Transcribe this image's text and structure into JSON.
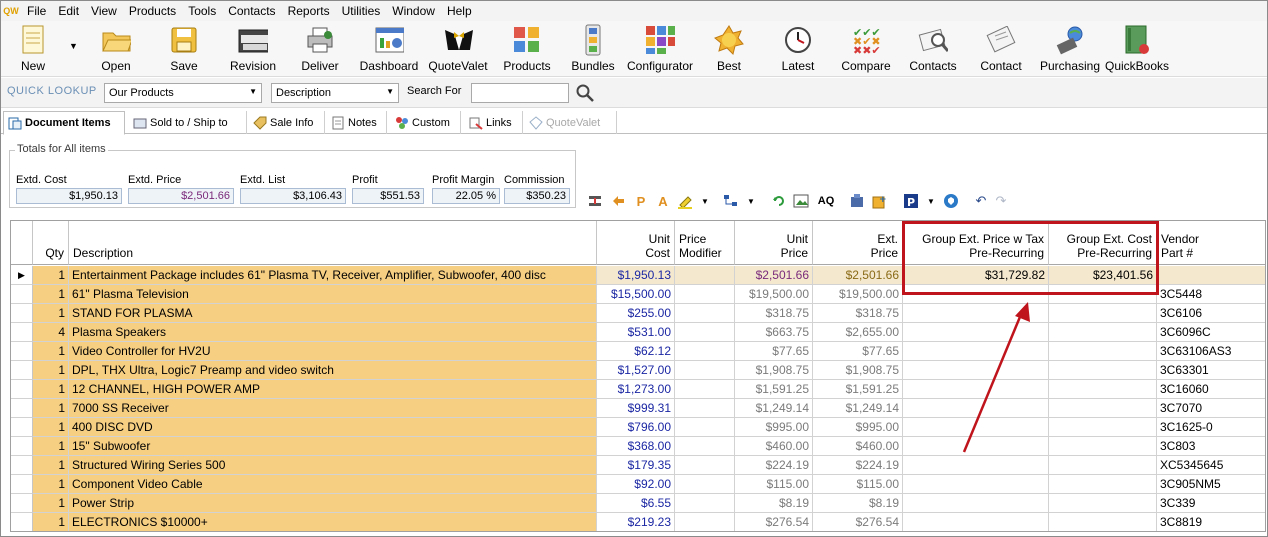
{
  "menu": [
    "File",
    "Edit",
    "View",
    "Products",
    "Tools",
    "Contacts",
    "Reports",
    "Utilities",
    "Window",
    "Help"
  ],
  "app_logo": "QW",
  "toolbar": [
    {
      "label": "New",
      "icon": "new-document-icon"
    },
    {
      "label": "Open",
      "icon": "open-folder-icon"
    },
    {
      "label": "Save",
      "icon": "save-disk-icon"
    },
    {
      "label": "Revision",
      "icon": "revision-icon"
    },
    {
      "label": "Deliver",
      "icon": "deliver-printer-icon"
    },
    {
      "label": "Dashboard",
      "icon": "dashboard-icon"
    },
    {
      "label": "QuoteValet",
      "icon": "quotevalet-tuxedo-icon"
    },
    {
      "label": "Products",
      "icon": "products-icon"
    },
    {
      "label": "Bundles",
      "icon": "bundles-icon"
    },
    {
      "label": "Configurator",
      "icon": "configurator-icon"
    },
    {
      "label": "Best",
      "icon": "best-badge-icon"
    },
    {
      "label": "Latest",
      "icon": "latest-clock-icon"
    },
    {
      "label": "Compare",
      "icon": "compare-check-icon"
    },
    {
      "label": "Contacts",
      "icon": "contacts-icon"
    },
    {
      "label": "Contact",
      "icon": "contact-card-icon"
    },
    {
      "label": "Purchasing",
      "icon": "purchasing-globe-icon"
    },
    {
      "label": "QuickBooks",
      "icon": "quickbooks-book-icon"
    }
  ],
  "lookup": {
    "label": "QUICK LOOKUP",
    "source": "Our Products",
    "field": "Description",
    "search_label": "Search For",
    "search_value": ""
  },
  "tabs": [
    {
      "label": "Document Items"
    },
    {
      "label": "Sold to / Ship to"
    },
    {
      "label": "Sale Info"
    },
    {
      "label": "Notes"
    },
    {
      "label": "Custom"
    },
    {
      "label": "Links"
    },
    {
      "label": "QuoteValet"
    }
  ],
  "totals": {
    "title": "Totals for All items",
    "items": [
      {
        "label": "Extd. Cost",
        "value": "$1,950.13"
      },
      {
        "label": "Extd. Price",
        "value": "$2,501.66"
      },
      {
        "label": "Extd. List",
        "value": "$3,106.43"
      },
      {
        "label": "Profit",
        "value": "$551.53"
      },
      {
        "label": "Profit Margin",
        "value": "22.05 %"
      },
      {
        "label": "Commission",
        "value": "$350.23"
      }
    ]
  },
  "grid_tools": {
    "letter_p": "P",
    "letter_a": "A",
    "letters_aq": "AQ"
  },
  "headers": {
    "qty": "Qty",
    "description": "Description",
    "unit_cost": [
      "Unit",
      "Cost"
    ],
    "price_modifier": [
      "Price",
      "Modifier"
    ],
    "unit_price": [
      "Unit",
      "Price"
    ],
    "ext_price": [
      "Ext.",
      "Price"
    ],
    "group_ext_price": [
      "Group Ext. Price w Tax",
      "Pre-Recurring"
    ],
    "group_ext_cost": [
      "Group Ext. Cost",
      "Pre-Recurring"
    ],
    "vendor_part": [
      "Vendor",
      "Part #"
    ]
  },
  "rows": [
    {
      "qty": "1",
      "description": "Entertainment Package includes 61\" Plasma TV, Receiver, Amplifier, Subwoofer, 400 disc",
      "unit_cost": "$1,950.13",
      "price_modifier": "",
      "unit_price": "$2,501.66",
      "ext_price": "$2,501.66",
      "group_ext_price": "$31,729.82",
      "group_ext_cost": "$23,401.56",
      "vendor_part": ""
    },
    {
      "qty": "1",
      "description": "61\" Plasma Television",
      "unit_cost": "$15,500.00",
      "price_modifier": "",
      "unit_price": "$19,500.00",
      "ext_price": "$19,500.00",
      "group_ext_price": "",
      "group_ext_cost": "",
      "vendor_part": "3C5448"
    },
    {
      "qty": "1",
      "description": "STAND FOR PLASMA",
      "unit_cost": "$255.00",
      "price_modifier": "",
      "unit_price": "$318.75",
      "ext_price": "$318.75",
      "group_ext_price": "",
      "group_ext_cost": "",
      "vendor_part": "3C6106"
    },
    {
      "qty": "4",
      "description": "Plasma Speakers",
      "unit_cost": "$531.00",
      "price_modifier": "",
      "unit_price": "$663.75",
      "ext_price": "$2,655.00",
      "group_ext_price": "",
      "group_ext_cost": "",
      "vendor_part": "3C6096C"
    },
    {
      "qty": "1",
      "description": "Video Controller for HV2U",
      "unit_cost": "$62.12",
      "price_modifier": "",
      "unit_price": "$77.65",
      "ext_price": "$77.65",
      "group_ext_price": "",
      "group_ext_cost": "",
      "vendor_part": "3C63106AS3"
    },
    {
      "qty": "1",
      "description": "DPL, THX Ultra, Logic7 Preamp and video switch",
      "unit_cost": "$1,527.00",
      "price_modifier": "",
      "unit_price": "$1,908.75",
      "ext_price": "$1,908.75",
      "group_ext_price": "",
      "group_ext_cost": "",
      "vendor_part": "3C63301"
    },
    {
      "qty": "1",
      "description": "12 CHANNEL, HIGH POWER AMP",
      "unit_cost": "$1,273.00",
      "price_modifier": "",
      "unit_price": "$1,591.25",
      "ext_price": "$1,591.25",
      "group_ext_price": "",
      "group_ext_cost": "",
      "vendor_part": "3C16060"
    },
    {
      "qty": "1",
      "description": "7000 SS Receiver",
      "unit_cost": "$999.31",
      "price_modifier": "",
      "unit_price": "$1,249.14",
      "ext_price": "$1,249.14",
      "group_ext_price": "",
      "group_ext_cost": "",
      "vendor_part": "3C7070"
    },
    {
      "qty": "1",
      "description": "400 DISC DVD",
      "unit_cost": "$796.00",
      "price_modifier": "",
      "unit_price": "$995.00",
      "ext_price": "$995.00",
      "group_ext_price": "",
      "group_ext_cost": "",
      "vendor_part": "3C1625-0"
    },
    {
      "qty": "1",
      "description": "15\" Subwoofer",
      "unit_cost": "$368.00",
      "price_modifier": "",
      "unit_price": "$460.00",
      "ext_price": "$460.00",
      "group_ext_price": "",
      "group_ext_cost": "",
      "vendor_part": "3C803"
    },
    {
      "qty": "1",
      "description": "Structured Wiring Series 500",
      "unit_cost": "$179.35",
      "price_modifier": "",
      "unit_price": "$224.19",
      "ext_price": "$224.19",
      "group_ext_price": "",
      "group_ext_cost": "",
      "vendor_part": "XC5345645"
    },
    {
      "qty": "1",
      "description": "Component Video Cable",
      "unit_cost": "$92.00",
      "price_modifier": "",
      "unit_price": "$115.00",
      "ext_price": "$115.00",
      "group_ext_price": "",
      "group_ext_cost": "",
      "vendor_part": "3C905NM5"
    },
    {
      "qty": "1",
      "description": "Power Strip",
      "unit_cost": "$6.55",
      "price_modifier": "",
      "unit_price": "$8.19",
      "ext_price": "$8.19",
      "group_ext_price": "",
      "group_ext_cost": "",
      "vendor_part": "3C339"
    },
    {
      "qty": "1",
      "description": "ELECTRONICS $10000+",
      "unit_cost": "$219.23",
      "price_modifier": "",
      "unit_price": "$276.54",
      "ext_price": "$276.54",
      "group_ext_price": "",
      "group_ext_cost": "",
      "vendor_part": "3C8819"
    }
  ],
  "colors": {
    "accent_highlight": "#c0141c",
    "description_fill": "#f6cf83",
    "cost_text": "#1b27a3",
    "price_text": "#7a2a7a",
    "ext_price_text": "#8a6a16"
  }
}
